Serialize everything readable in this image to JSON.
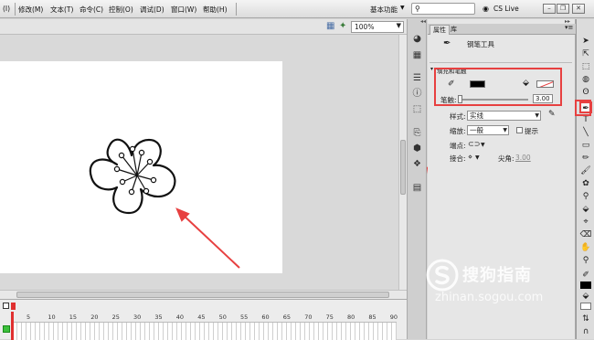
{
  "menubar": {
    "items": [
      "(I)",
      "修改(M)",
      "文本(T)",
      "命令(C)",
      "控制(O)",
      "调试(D)",
      "窗口(W)",
      "帮助(H)"
    ],
    "workspace": "基本功能",
    "cs_live": "CS Live"
  },
  "stagebar": {
    "zoom": "100%"
  },
  "timeline": {
    "frame_numbers": [
      "5",
      "10",
      "15",
      "20",
      "25",
      "30",
      "35",
      "40",
      "45",
      "50",
      "55",
      "60",
      "65",
      "70",
      "75",
      "80",
      "85",
      "90"
    ]
  },
  "props": {
    "tabs": [
      "属性",
      "库"
    ],
    "tool_name": "钢笔工具",
    "section_fill_stroke": "填充和笔触",
    "stroke_label": "笔触:",
    "stroke_value": "3.00",
    "style_label": "样式:",
    "style_value": "实线",
    "scale_label": "缩放:",
    "scale_value": "一般",
    "hint_label": "提示",
    "cap_label": "端点:",
    "join_label": "接合:",
    "miter_label": "尖角:",
    "miter_value": "3.00"
  },
  "watermark": {
    "brand": "搜狗指南",
    "url": "zhinan.sogou.com"
  },
  "colors": {
    "annotation_red": "#e74040",
    "stroke_swatch": "#000000",
    "stage": "#ffffff"
  }
}
